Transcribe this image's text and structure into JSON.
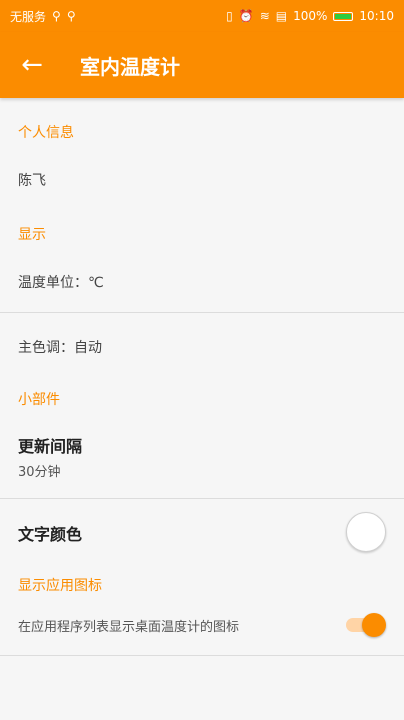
{
  "status_bar": {
    "carrier": "无服务",
    "battery_percent": "100%",
    "time": "10:10",
    "icons": [
      "usb-icon",
      "usb-icon",
      "vibrate-icon",
      "alarm-icon",
      "wifi-icon",
      "sim-icon",
      "battery-icon"
    ]
  },
  "app_bar": {
    "back_icon": "arrow-left-icon",
    "title": "室内温度计"
  },
  "sections": {
    "personal": {
      "header": "个人信息",
      "name": "陈飞"
    },
    "display": {
      "header": "显示",
      "temp_unit": "温度单位：℃",
      "theme_color": "主色调：自动"
    },
    "widget": {
      "header": "小部件",
      "update_interval_title": "更新间隔",
      "update_interval_value": "30分钟",
      "text_color_title": "文字颜色"
    },
    "app_icon": {
      "header": "显示应用图标",
      "description": "在应用程序列表显示桌面温度计的图标",
      "enabled": true
    }
  },
  "colors": {
    "accent": "#fb8c00"
  }
}
